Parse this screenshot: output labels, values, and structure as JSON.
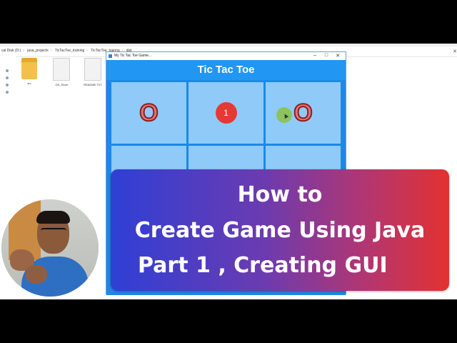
{
  "explorer": {
    "breadcrumbs": [
      "cal Disk (D:)",
      "java_projects",
      "TicTacToe_training",
      "TicTacToe_trainng",
      "dist"
    ],
    "files": [
      {
        "label": "src",
        "icon": "folder-icon"
      },
      {
        "label": ".DS_Store",
        "icon": "file-icon"
      },
      {
        "label": "README.TXT",
        "icon": "file-icon"
      }
    ]
  },
  "app_window": {
    "window_title": "My Tic Tac Toe Game...",
    "header": "Tic Tac Toe",
    "board": {
      "cells": [
        "O",
        "1",
        "O",
        "",
        "",
        "",
        "",
        "",
        ""
      ]
    },
    "colors": {
      "header": "#2196f3",
      "cell": "#90caf9",
      "o_mark": "#e57373",
      "badge": "#e53935",
      "cursor": "#8bc34a"
    }
  },
  "banner": {
    "line1": "How to",
    "line2": "Create Game Using Java",
    "line3": "Part 1 , Creating GUI"
  }
}
